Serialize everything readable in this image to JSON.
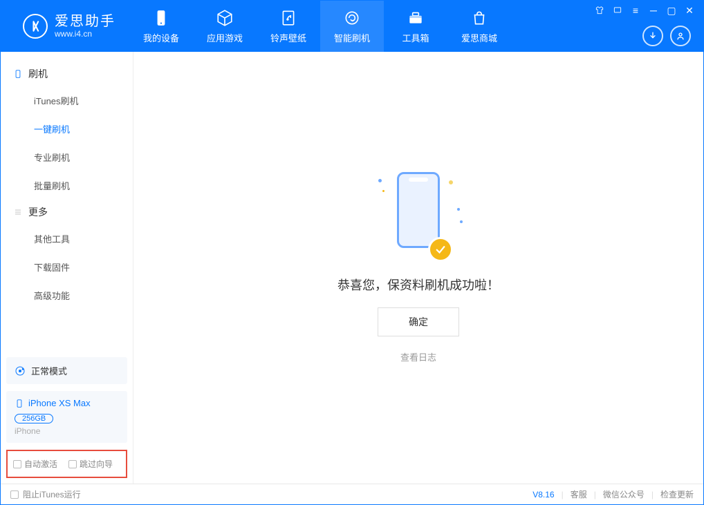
{
  "app": {
    "name_cn": "爱思助手",
    "url": "www.i4.cn"
  },
  "nav": {
    "items": [
      {
        "label": "我的设备"
      },
      {
        "label": "应用游戏"
      },
      {
        "label": "铃声壁纸"
      },
      {
        "label": "智能刷机"
      },
      {
        "label": "工具箱"
      },
      {
        "label": "爱思商城"
      }
    ]
  },
  "sidebar": {
    "section1": {
      "title": "刷机",
      "items": [
        "iTunes刷机",
        "一键刷机",
        "专业刷机",
        "批量刷机"
      ]
    },
    "section2": {
      "title": "更多",
      "items": [
        "其他工具",
        "下载固件",
        "高级功能"
      ]
    },
    "mode": "正常模式",
    "device": {
      "name": "iPhone XS Max",
      "capacity": "256GB",
      "type": "iPhone"
    },
    "chk1": "自动激活",
    "chk2": "跳过向导"
  },
  "main": {
    "success": "恭喜您，保资料刷机成功啦！",
    "confirm": "确定",
    "view_log": "查看日志"
  },
  "footer": {
    "block_itunes": "阻止iTunes运行",
    "version": "V8.16",
    "links": [
      "客服",
      "微信公众号",
      "检查更新"
    ]
  }
}
